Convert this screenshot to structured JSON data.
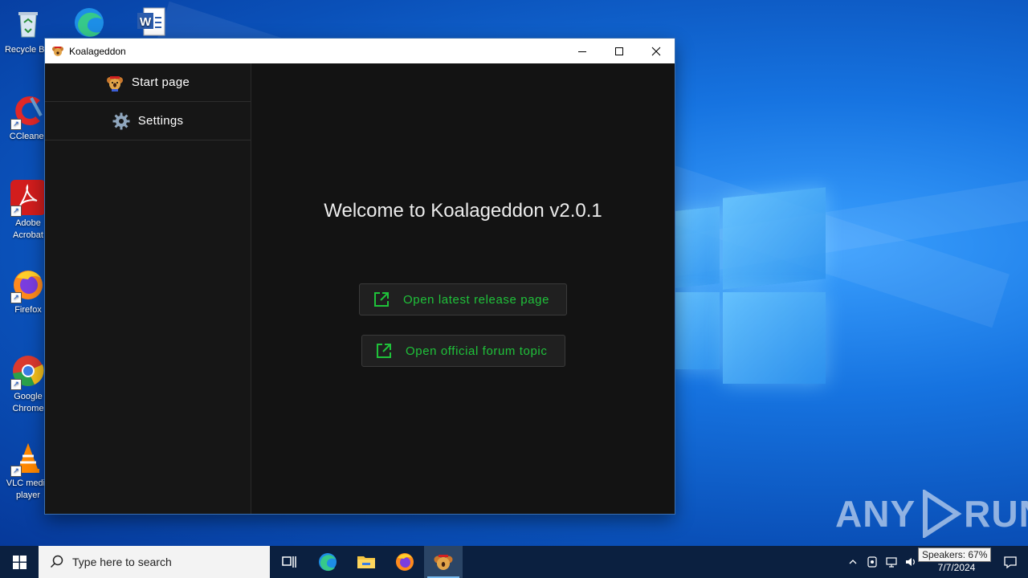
{
  "desktop": {
    "icons": [
      {
        "label": "Recycle Bin",
        "icon": "recycle-bin-icon"
      },
      {
        "label": "",
        "icon": "edge-icon"
      },
      {
        "label": "",
        "icon": "word-document-icon"
      },
      {
        "label": "CCleaner",
        "icon": "ccleaner-icon"
      },
      {
        "label": "Adobe Acrobat",
        "icon": "acrobat-icon"
      },
      {
        "label": "Firefox",
        "icon": "firefox-icon"
      },
      {
        "label": "Google Chrome",
        "icon": "chrome-icon"
      },
      {
        "label": "VLC media player",
        "icon": "vlc-icon"
      }
    ],
    "watermark": "ANY RUN"
  },
  "window": {
    "title": "Koalageddon",
    "controls": {
      "minimize": "minimize",
      "maximize": "maximize",
      "close": "close"
    }
  },
  "sidebar": {
    "items": [
      {
        "label": "Start page",
        "icon": "koala-icon"
      },
      {
        "label": "Settings",
        "icon": "gear-icon"
      }
    ]
  },
  "main": {
    "welcome": "Welcome to Koalageddon v2.0.1",
    "buttons": [
      {
        "label": "Open latest release page",
        "icon": "external-link-icon"
      },
      {
        "label": "Open official forum topic",
        "icon": "external-link-icon"
      }
    ]
  },
  "taskbar": {
    "search_placeholder": "Type here to search",
    "pinned": [
      "task-view-icon",
      "edge-icon",
      "file-explorer-icon",
      "firefox-icon",
      "koalageddon-icon"
    ],
    "clock_time": "",
    "clock_date": "7/7/2024",
    "tooltip": "Speakers: 67%"
  },
  "colors": {
    "accent_green": "#1fc23a",
    "app_background": "#131313",
    "taskbar": "#0b2040"
  }
}
